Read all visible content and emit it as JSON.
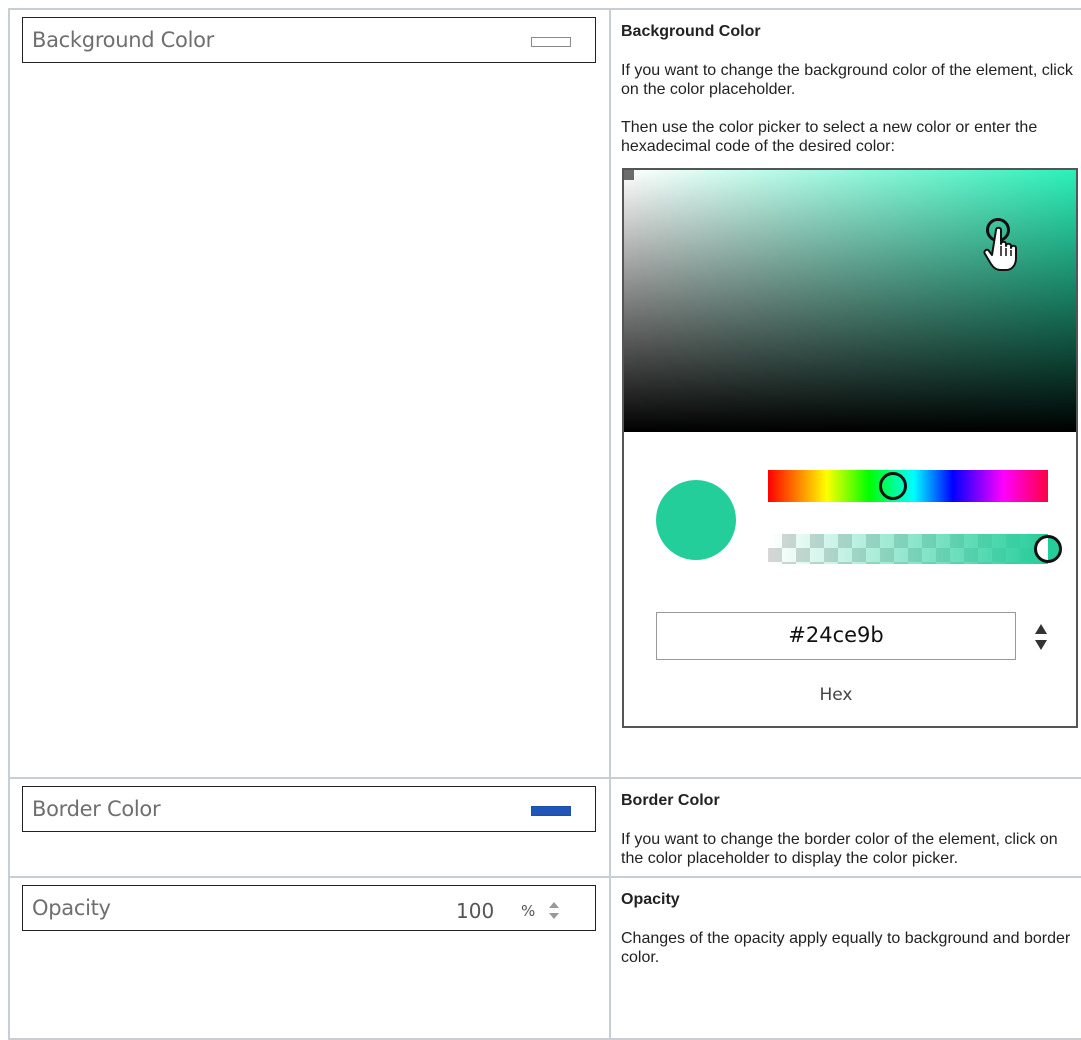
{
  "rows": [
    {
      "widget_label": "Background Color",
      "heading": "Background Color",
      "paragraphs": [
        "If you want to change the background color of the element, click on the color placeholder.",
        "Then use the color picker to select a new color or enter the hexadecimal code of the desired color:"
      ]
    },
    {
      "widget_label": "Border Color",
      "heading": "Border Color",
      "paragraphs": [
        "If you want to change the border color of the element, click on the color placeholder to display the color picker."
      ]
    },
    {
      "widget_label": "Opacity",
      "widget_value": "100",
      "widget_unit": "%",
      "heading": "Opacity",
      "paragraphs": [
        "Changes of the opacity apply equally to background and border color."
      ]
    }
  ],
  "picker": {
    "hex_value": "#24ce9b",
    "hex_label": "Hex",
    "selected_color": "#24ce9b"
  },
  "colors": {
    "border_swatch": "#1f56b8",
    "grid_border": "#c9ced6"
  },
  "icons": {
    "cursor": "hand-pointer-icon",
    "stepper": "up-down-arrows-icon"
  }
}
